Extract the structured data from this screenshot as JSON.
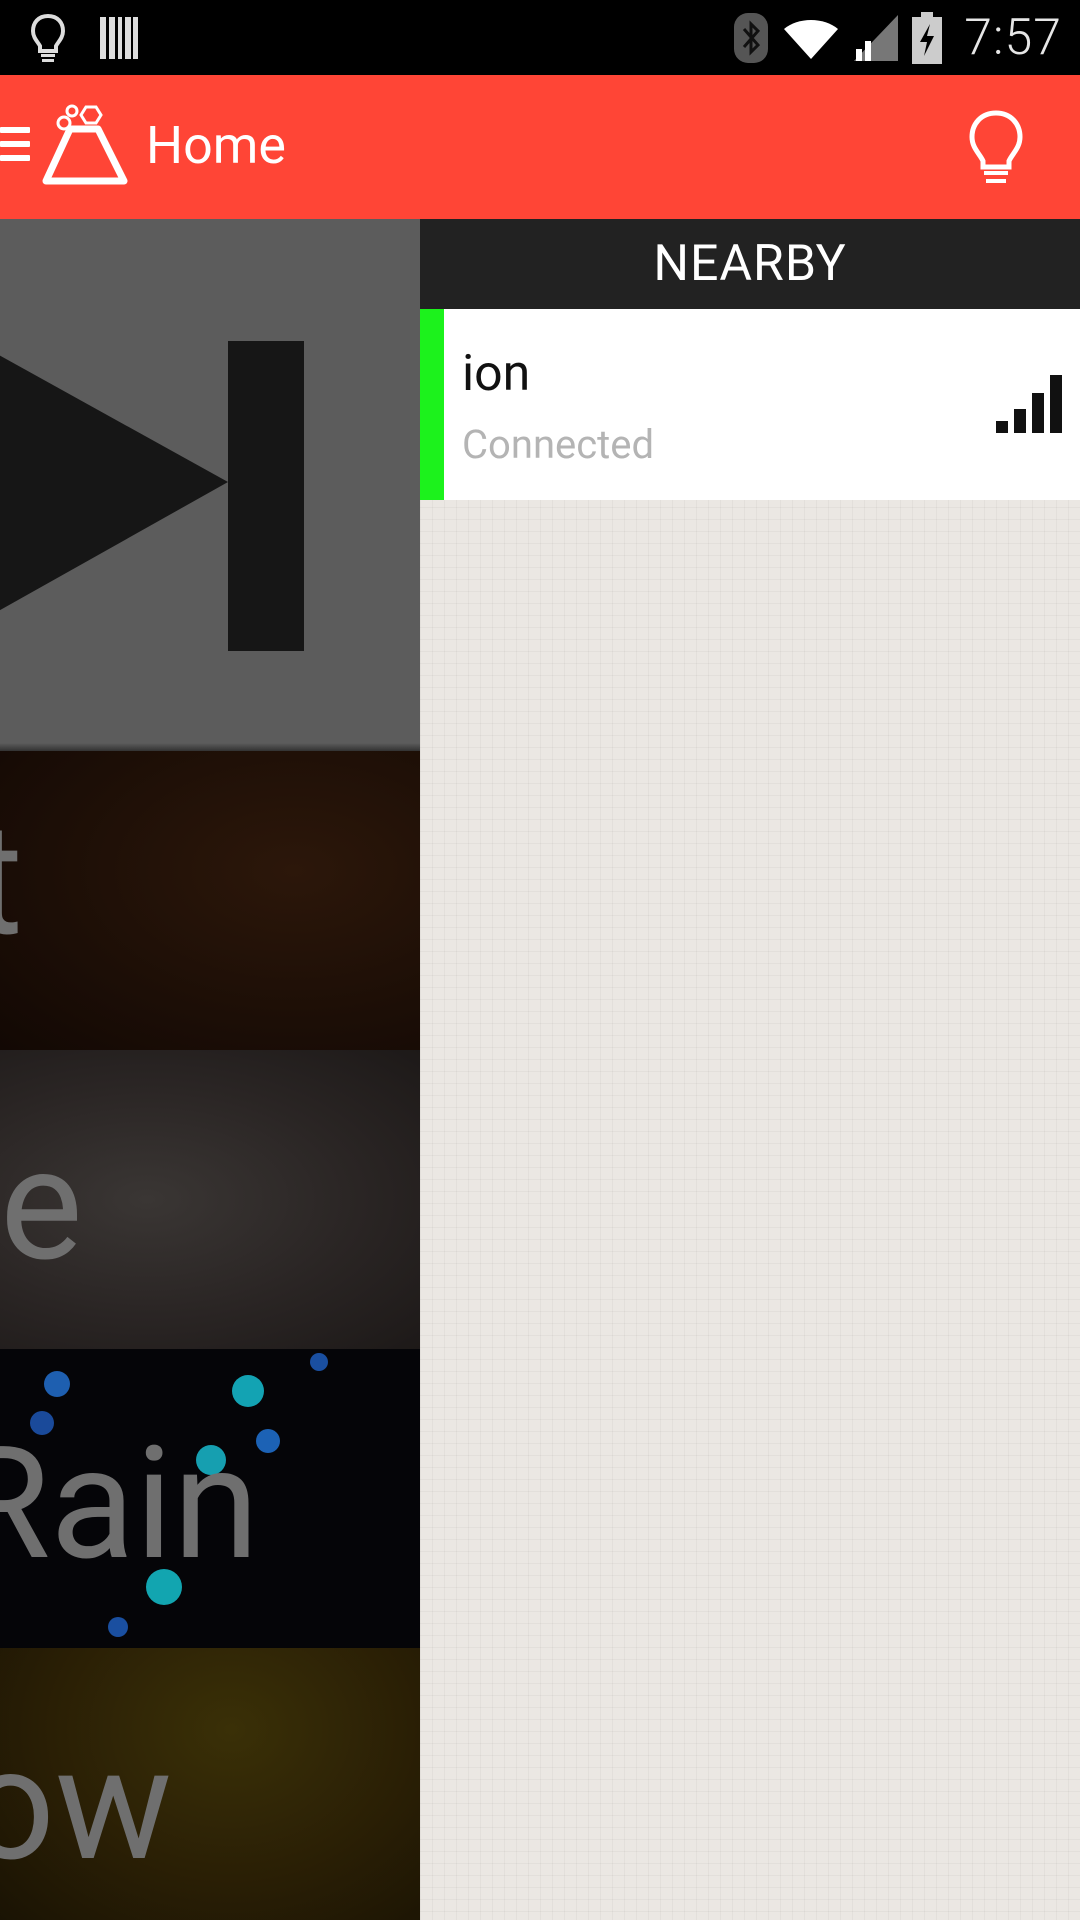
{
  "status_bar": {
    "time": "7:57",
    "left_icons": [
      "lightbulb-icon",
      "barcode-icon"
    ],
    "right_icons": [
      "bluetooth-icon",
      "wifi-icon",
      "cell-signal-icon",
      "battery-charging-icon"
    ]
  },
  "action_bar": {
    "title": "Home",
    "nav_icon": "hamburger-icon",
    "logo_icon": "flask-logo-icon",
    "action_icon": "lightbulb-icon",
    "color": "#ff4536"
  },
  "content": {
    "tiles": [
      {
        "label": "",
        "icon": "skip-next-icon"
      },
      {
        "label": "t"
      },
      {
        "label": "e"
      },
      {
        "label": "Rain"
      },
      {
        "label": "ow"
      }
    ]
  },
  "nearby": {
    "header": "NEARBY",
    "devices": [
      {
        "name": "ion",
        "status": "Connected",
        "status_color": "#1cf21c",
        "signal_icon": "signal-strength-icon"
      }
    ]
  }
}
